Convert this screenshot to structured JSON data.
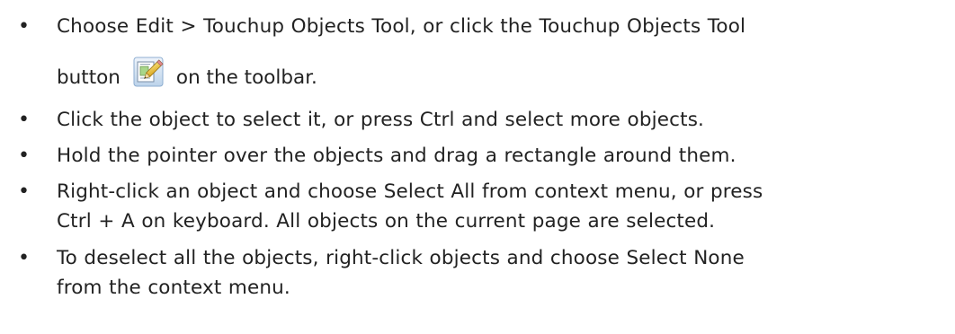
{
  "bullet_glyph": "•",
  "items": [
    {
      "lines": [
        "Choose Edit > Touchup Objects Tool, or click the Touchup Objects Tool"
      ],
      "tool_line_before": "button",
      "tool_icon": "touchup-objects-tool-icon",
      "tool_line_after": "on the toolbar."
    },
    {
      "lines": [
        "Click the object to select it, or press Ctrl and select more objects."
      ]
    },
    {
      "lines": [
        "Hold the pointer over the objects and drag a rectangle around them."
      ]
    },
    {
      "lines": [
        "Right-click an object and choose Select All from context menu, or press",
        "Ctrl + A on keyboard. All objects on the current page are selected."
      ]
    },
    {
      "lines": [
        "To deselect all the objects, right-click objects and choose Select None",
        "from the context menu."
      ]
    }
  ]
}
